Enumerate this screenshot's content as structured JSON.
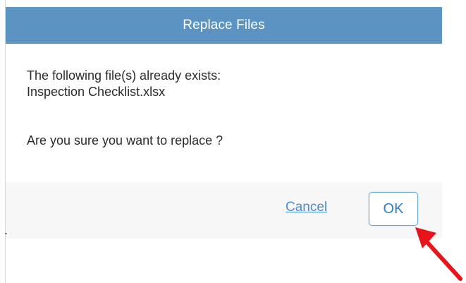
{
  "dialog": {
    "title": "Replace Files",
    "message_line1": "The following file(s) already exists:",
    "filename": "Inspection Checklist.xlsx",
    "question": "Are you sure you want to replace ?",
    "cancel_label": "Cancel",
    "ok_label": "OK"
  },
  "colors": {
    "title_bar": "#5b93c3",
    "link": "#4a8fd1",
    "annotation_arrow": "#e8141b"
  },
  "icons": {
    "annotation": "red-arrow-icon"
  }
}
